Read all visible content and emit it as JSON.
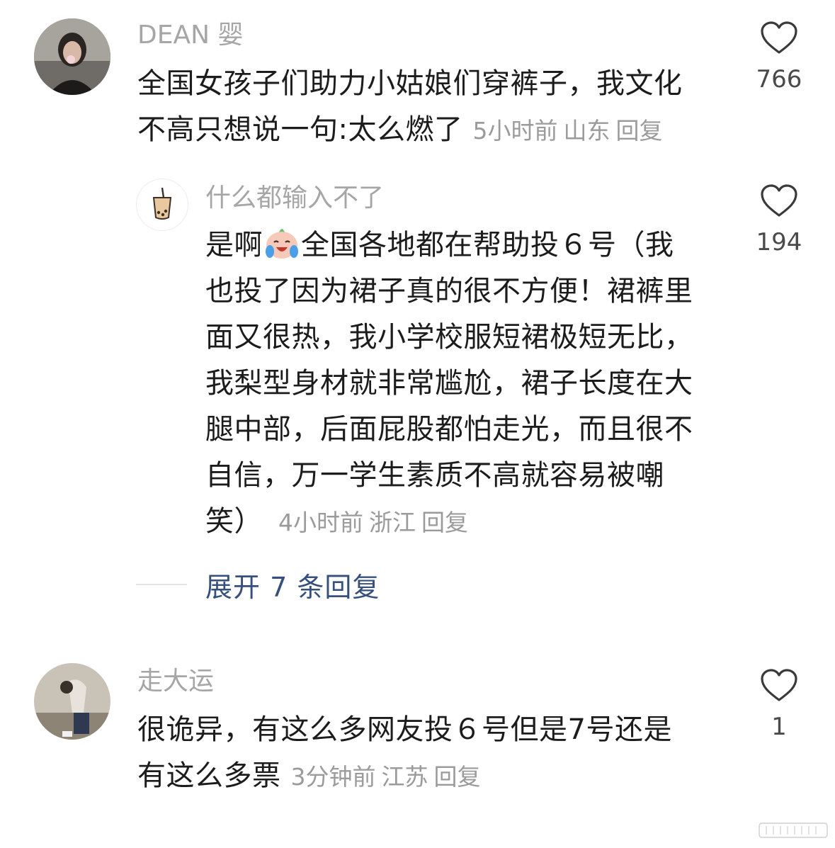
{
  "comments": [
    {
      "username": "DEAN 婴",
      "lines": [
        "全国女孩子们助力小姑娘们穿裤子，我文化",
        "不高只想说一句:太么燃了"
      ],
      "time": "5小时前",
      "location": "山东",
      "reply": "回复",
      "likes": "766"
    },
    {
      "username": "什么都输入不了",
      "line1_before_emoji": "是啊",
      "line1_after_emoji": "全国各地都在帮助投６号（我",
      "lines": [
        "也投了因为裙子真的很不方便！裙裤里",
        "面又很热，我小学校服短裙极短无比，",
        "我梨型身材就非常尴尬，裙子长度在大",
        "腿中部，后面屁股都怕走光，而且很不",
        "自信，万一学生素质不高就容易被嘲",
        "笑）"
      ],
      "time": "4小时前",
      "location": "浙江",
      "reply": "回复",
      "likes": "194",
      "emoji_icon": "crying-laughing-face"
    },
    {
      "username": "走大运",
      "lines": [
        "很诡异，有这么多网友投６号但是7号还是",
        "有这么多票"
      ],
      "time": "3分钟前",
      "location": "江苏",
      "reply": "回复",
      "likes": "1"
    }
  ],
  "expand_replies": "展开 7 条回复",
  "colors": {
    "username": "#a6a6a6",
    "text": "#1c1c1c",
    "meta": "#9b9b9b",
    "link": "#35507c",
    "heart_outline": "#3a3a3a"
  }
}
